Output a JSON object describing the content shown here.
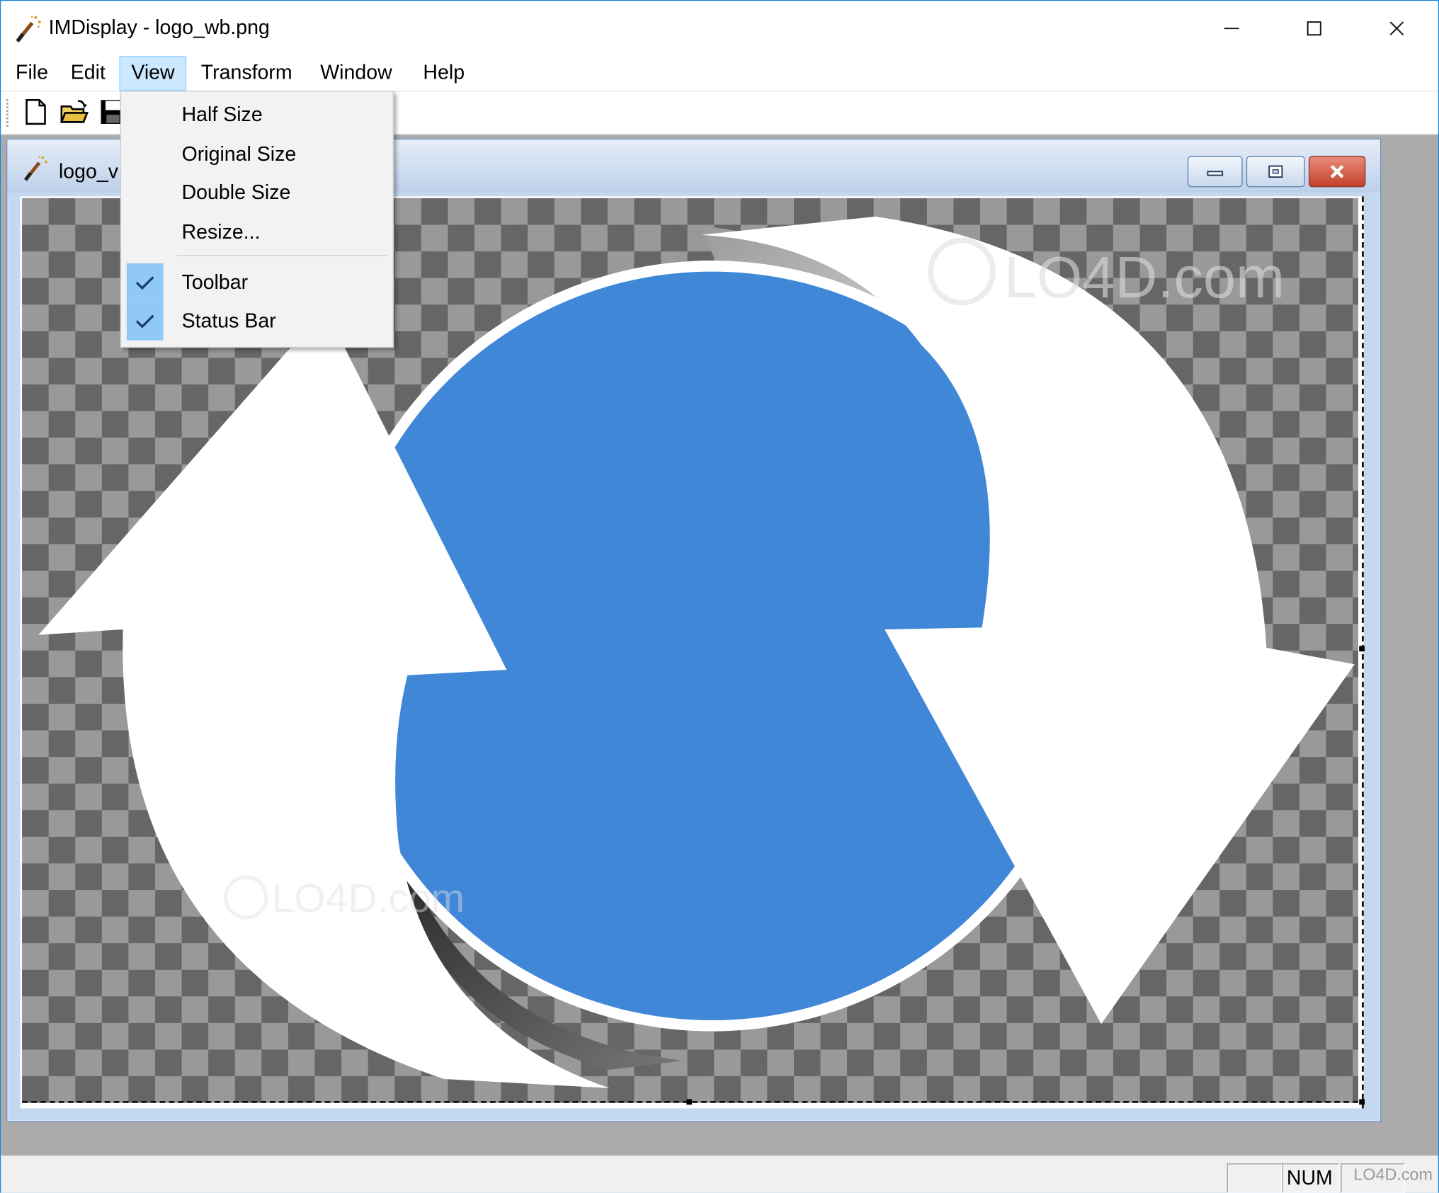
{
  "window": {
    "title": "IMDisplay - logo_wb.png",
    "minimize_glyph": "—",
    "maximize_glyph": "☐",
    "close_glyph": "✕"
  },
  "menubar": {
    "items": [
      {
        "label": "File"
      },
      {
        "label": "Edit"
      },
      {
        "label": "View",
        "active": true
      },
      {
        "label": "Transform"
      },
      {
        "label": "Window"
      },
      {
        "label": "Help"
      }
    ]
  },
  "view_menu": {
    "items": [
      {
        "label": "Half Size",
        "checked": false
      },
      {
        "label": "Original Size",
        "checked": false
      },
      {
        "label": "Double Size",
        "checked": false
      },
      {
        "label": "Resize...",
        "checked": false
      },
      {
        "label": "Toolbar",
        "checked": true
      },
      {
        "label": "Status Bar",
        "checked": true
      }
    ],
    "check_glyph": "✔"
  },
  "toolbar": {
    "buttons": [
      {
        "icon": "new-document-icon"
      },
      {
        "icon": "open-folder-icon"
      },
      {
        "icon": "save-disk-icon"
      }
    ]
  },
  "child_window": {
    "title": "logo_v"
  },
  "image": {
    "watermark_top": "LO4D.com",
    "watermark_bottom": "LO4D.com",
    "circle_color": "#4187d8",
    "arrow_color": "#ffffff",
    "checker_dark": "#666666",
    "checker_light": "#999999"
  },
  "statusbar": {
    "num_indicator": "NUM",
    "watermark": "LO4D.com"
  },
  "colors": {
    "window_border": "#1883d7",
    "menu_active_bg": "#cce8ff",
    "check_bg": "#90c8f6",
    "mdi_bg": "#ababab",
    "close_button_red": "#c4402c"
  }
}
